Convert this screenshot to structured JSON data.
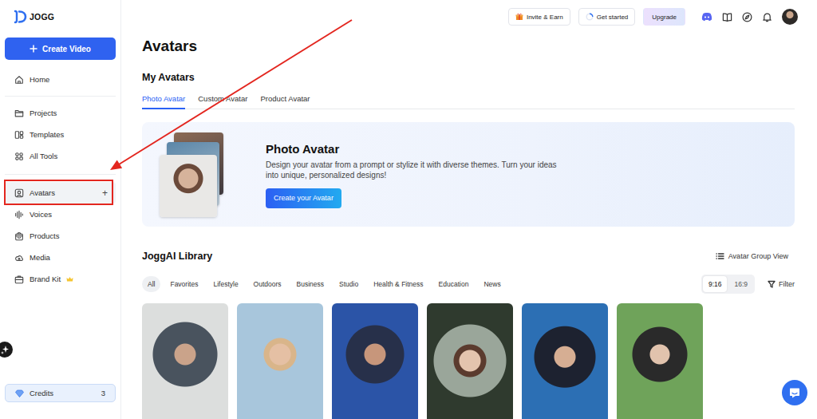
{
  "logo": {
    "text": "JOGG"
  },
  "sidebar": {
    "create_button": "Create Video",
    "groups": [
      [
        {
          "label": "Home",
          "selected": false
        }
      ],
      [
        {
          "label": "Projects",
          "selected": false
        },
        {
          "label": "Templates",
          "selected": false
        },
        {
          "label": "All Tools",
          "selected": false
        }
      ],
      [
        {
          "label": "Avatars",
          "selected": true,
          "action": "+"
        },
        {
          "label": "Voices",
          "selected": false
        },
        {
          "label": "Products",
          "selected": false
        },
        {
          "label": "Media",
          "selected": false
        },
        {
          "label": "Brand Kit",
          "selected": false
        }
      ]
    ],
    "credits": {
      "label": "Credits",
      "value": "3"
    }
  },
  "topbar": {
    "buttons": [
      {
        "label": "Invite & Earn",
        "kind": "gift"
      },
      {
        "label": "Get started",
        "kind": "progress"
      },
      {
        "label": "Upgrade",
        "kind": "upgrade"
      }
    ]
  },
  "page": {
    "title": "Avatars"
  },
  "my_avatars": {
    "title": "My Avatars",
    "tabs": [
      {
        "label": "Photo Avatar",
        "selected": true
      },
      {
        "label": "Custom Avatar",
        "selected": false
      },
      {
        "label": "Product Avatar",
        "selected": false
      }
    ]
  },
  "banner": {
    "title": "Photo Avatar",
    "description": "Design your avatar from a prompt or stylize it with diverse themes. Turn your ideas into unique, personalized designs!",
    "button": "Create your Avatar"
  },
  "library": {
    "title": "JoggAI Library",
    "view_button": "Avatar Group View",
    "categories": [
      {
        "label": "All",
        "selected": true
      },
      {
        "label": "Favorites",
        "selected": false
      },
      {
        "label": "Lifestyle",
        "selected": false
      },
      {
        "label": "Outdoors",
        "selected": false
      },
      {
        "label": "Business",
        "selected": false
      },
      {
        "label": "Studio",
        "selected": false
      },
      {
        "label": "Health & Fitness",
        "selected": false
      },
      {
        "label": "Education",
        "selected": false
      },
      {
        "label": "News",
        "selected": false
      }
    ],
    "ratios": [
      {
        "label": "9:16",
        "selected": true
      },
      {
        "label": "16:9",
        "selected": false
      }
    ],
    "filter": "Filter"
  }
}
